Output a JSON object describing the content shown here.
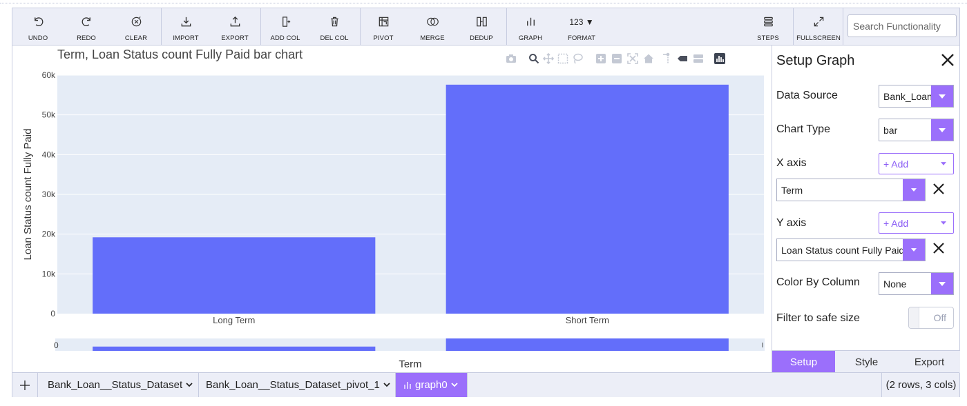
{
  "toolbar": {
    "undo": "UNDO",
    "redo": "REDO",
    "clear": "CLEAR",
    "import": "IMPORT",
    "export": "EXPORT",
    "add_col": "ADD COL",
    "del_col": "DEL COL",
    "pivot": "PIVOT",
    "merge": "MERGE",
    "dedup": "DEDUP",
    "graph": "GRAPH",
    "format_icon": "123 ▼",
    "format": "FORMAT",
    "steps": "STEPS",
    "fullscreen": "FULLSCREEN",
    "search_placeholder": "Search Functionality"
  },
  "chart_data": {
    "type": "bar",
    "title": "Term, Loan Status count Fully Paid bar chart",
    "xlabel": "Term",
    "ylabel": "Loan Status count Fully Paid",
    "categories": [
      "Long Term",
      "Short Term"
    ],
    "values": [
      19200,
      57600
    ],
    "ylim": [
      0,
      60000
    ],
    "yticks": [
      0,
      10000,
      20000,
      30000,
      40000,
      50000,
      60000
    ],
    "ytick_labels": [
      "0",
      "10k",
      "20k",
      "30k",
      "40k",
      "50k",
      "60k"
    ],
    "bar_color": "#636efa",
    "plot_bg": "#e5ecf6",
    "rangeslider": true,
    "rangeslider_tick": "0"
  },
  "setup_panel": {
    "title": "Setup Graph",
    "data_source_label": "Data Source",
    "data_source_value": "Bank_Loan",
    "chart_type_label": "Chart Type",
    "chart_type_value": "bar",
    "x_axis_label": "X axis",
    "x_axis_add": "+ Add",
    "x_axis_value": "Term",
    "y_axis_label": "Y axis",
    "y_axis_add": "+ Add",
    "y_axis_value": "Loan Status count Fully Paid",
    "color_by_label": "Color By Column",
    "color_by_value": "None",
    "filter_label": "Filter to safe size",
    "filter_toggle": "Off",
    "tabs": [
      "Setup",
      "Style",
      "Export"
    ]
  },
  "bottom_bar": {
    "tabs": [
      "Bank_Loan__Status_Dataset",
      "Bank_Loan__Status_Dataset_pivot_1",
      "graph0"
    ],
    "status": "(2 rows, 3 cols)"
  },
  "colors": {
    "accent": "#9b6ffb",
    "toolbar_bg": "#eceef7",
    "bar": "#636efa"
  }
}
